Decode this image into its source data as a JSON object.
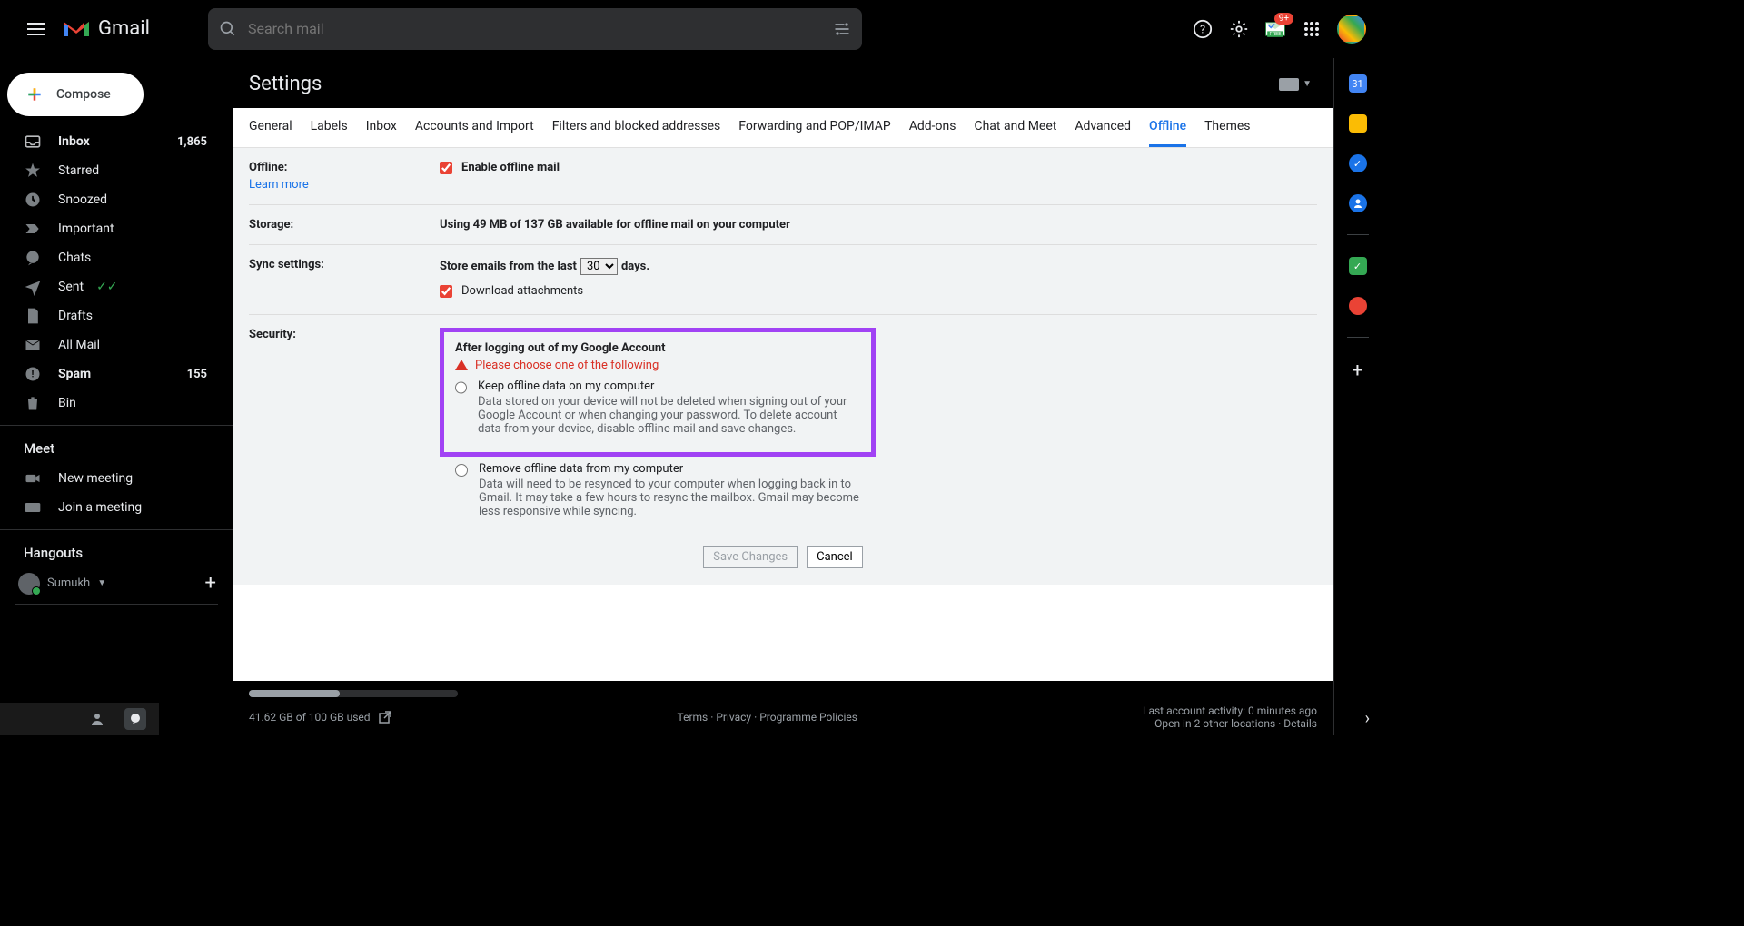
{
  "header": {
    "app_name": "Gmail",
    "search_placeholder": "Search mail",
    "notif_count": "9+",
    "free_label": "FREE"
  },
  "sidebar": {
    "compose": "Compose",
    "items": [
      {
        "label": "Inbox",
        "count": "1,865"
      },
      {
        "label": "Starred",
        "count": ""
      },
      {
        "label": "Snoozed",
        "count": ""
      },
      {
        "label": "Important",
        "count": ""
      },
      {
        "label": "Chats",
        "count": ""
      },
      {
        "label": "Sent",
        "count": ""
      },
      {
        "label": "Drafts",
        "count": ""
      },
      {
        "label": "All Mail",
        "count": ""
      },
      {
        "label": "Spam",
        "count": "155"
      },
      {
        "label": "Bin",
        "count": ""
      }
    ],
    "meet_title": "Meet",
    "meet_new": "New meeting",
    "meet_join": "Join a meeting",
    "hangouts_title": "Hangouts",
    "hangouts_user": "Sumukh"
  },
  "settings": {
    "title": "Settings",
    "tabs": [
      "General",
      "Labels",
      "Inbox",
      "Accounts and Import",
      "Filters and blocked addresses",
      "Forwarding and POP/IMAP",
      "Add-ons",
      "Chat and Meet",
      "Advanced",
      "Offline",
      "Themes"
    ],
    "active_tab": "Offline",
    "offline": {
      "label": "Offline:",
      "learn": "Learn more",
      "enable": "Enable offline mail"
    },
    "storage": {
      "label": "Storage:",
      "text": "Using 49 MB of 137 GB available for offline mail on your computer"
    },
    "sync": {
      "label": "Sync settings:",
      "pre": "Store emails from the last",
      "value": "30",
      "post": "days.",
      "download": "Download attachments"
    },
    "security": {
      "label": "Security:",
      "heading": "After logging out of my Google Account",
      "warn": "Please choose one of the following",
      "opt1_title": "Keep offline data on my computer",
      "opt1_desc": "Data stored on your device will not be deleted when signing out of your Google Account or when changing your password. To delete account data from your device, disable offline mail and save changes.",
      "opt2_title": "Remove offline data from my computer",
      "opt2_desc": "Data will need to be resynced to your computer when logging back in to Gmail. It may take a few hours to resync the mailbox. Gmail may become less responsive while syncing."
    },
    "save": "Save Changes",
    "cancel": "Cancel"
  },
  "footer": {
    "storage": "41.62 GB of 100 GB used",
    "terms": "Terms",
    "privacy": "Privacy",
    "policies": "Programme Policies",
    "activity": "Last account activity: 0 minutes ago",
    "locations": "Open in 2 other locations",
    "details": "Details"
  },
  "rail": {
    "cal": "31"
  }
}
